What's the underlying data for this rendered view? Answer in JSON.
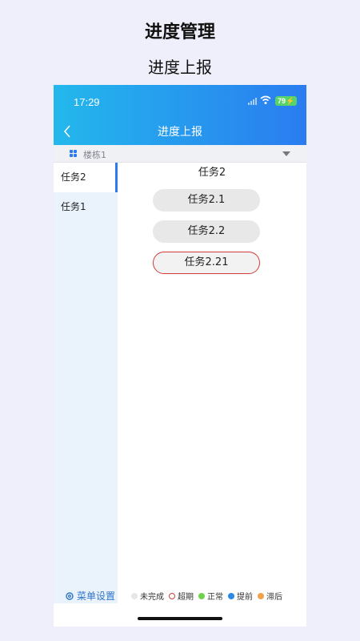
{
  "heading": {
    "title": "进度管理",
    "subtitle": "进度上报"
  },
  "status_bar": {
    "time": "17:29",
    "battery": "79"
  },
  "nav": {
    "title": "进度上报"
  },
  "building": {
    "label": "楼栋1"
  },
  "sidebar": {
    "items": [
      {
        "label": "任务2",
        "active": true
      },
      {
        "label": "任务1",
        "active": false
      }
    ]
  },
  "content": {
    "title": "任务2",
    "tasks": [
      {
        "label": "任务2.1",
        "status": "未完成"
      },
      {
        "label": "任务2.2",
        "status": "未完成"
      },
      {
        "label": "任务2.21",
        "status": "超期"
      }
    ]
  },
  "footer": {
    "menu_settings": "菜单设置",
    "legend": [
      {
        "label": "未完成",
        "color": "#e6e6e6"
      },
      {
        "label": "超期",
        "color": "#d23b3b"
      },
      {
        "label": "正常",
        "color": "#6fd14e"
      },
      {
        "label": "提前",
        "color": "#2a8ae6"
      },
      {
        "label": "滞后",
        "color": "#f0a24a"
      }
    ]
  }
}
